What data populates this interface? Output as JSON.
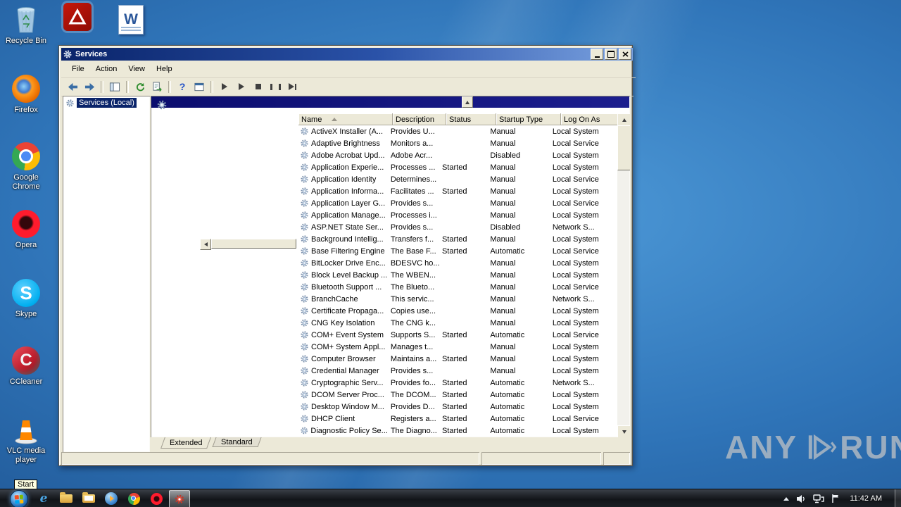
{
  "colors": {
    "selection_navy": "#0a246a",
    "titlebar_gradient": [
      "#0a246a",
      "#7aa2e0"
    ],
    "extended_header_navy": "#0d0f72",
    "desktop_blue": "#2f74b8",
    "taskbar_dark": "#121519"
  },
  "desktop": {
    "icons": [
      {
        "label": "Recycle Bin"
      },
      {
        "label": "Firefox"
      },
      {
        "label": "Google Chrome"
      },
      {
        "label": "Opera"
      },
      {
        "label": "Skype"
      },
      {
        "label": "CCleaner"
      },
      {
        "label": "VLC media player"
      }
    ],
    "top_shortcuts": [
      "adobe-reader",
      "word-document"
    ]
  },
  "watermark": {
    "left": "ANY",
    "right": "RUN"
  },
  "window": {
    "title": "Services",
    "menu_items": [
      "File",
      "Action",
      "View",
      "Help"
    ],
    "toolbar_buttons": [
      "back",
      "forward",
      "show-console-tree",
      "refresh",
      "export-list",
      "help",
      "properties",
      "start-service",
      "resume-service",
      "stop-service",
      "pause-service",
      "restart-service"
    ],
    "tree_root": "Services (Local)",
    "columns": [
      "Name",
      "Description",
      "Status",
      "Startup Type",
      "Log On As"
    ],
    "tabs": [
      "Extended",
      "Standard"
    ],
    "rows": [
      {
        "name": "ActiveX Installer (A...",
        "description": "Provides U...",
        "status": "",
        "startup_type": "Manual",
        "log_on_as": "Local System"
      },
      {
        "name": "Adaptive Brightness",
        "description": "Monitors a...",
        "status": "",
        "startup_type": "Manual",
        "log_on_as": "Local Service"
      },
      {
        "name": "Adobe Acrobat Upd...",
        "description": "Adobe Acr...",
        "status": "",
        "startup_type": "Disabled",
        "log_on_as": "Local System"
      },
      {
        "name": "Application Experie...",
        "description": "Processes ...",
        "status": "Started",
        "startup_type": "Manual",
        "log_on_as": "Local System"
      },
      {
        "name": "Application Identity",
        "description": "Determines...",
        "status": "",
        "startup_type": "Manual",
        "log_on_as": "Local Service"
      },
      {
        "name": "Application Informa...",
        "description": "Facilitates ...",
        "status": "Started",
        "startup_type": "Manual",
        "log_on_as": "Local System"
      },
      {
        "name": "Application Layer G...",
        "description": "Provides s...",
        "status": "",
        "startup_type": "Manual",
        "log_on_as": "Local Service"
      },
      {
        "name": "Application Manage...",
        "description": "Processes i...",
        "status": "",
        "startup_type": "Manual",
        "log_on_as": "Local System"
      },
      {
        "name": "ASP.NET State Ser...",
        "description": "Provides s...",
        "status": "",
        "startup_type": "Disabled",
        "log_on_as": "Network S..."
      },
      {
        "name": "Background Intellig...",
        "description": "Transfers f...",
        "status": "Started",
        "startup_type": "Manual",
        "log_on_as": "Local System"
      },
      {
        "name": "Base Filtering Engine",
        "description": "The Base F...",
        "status": "Started",
        "startup_type": "Automatic",
        "log_on_as": "Local Service"
      },
      {
        "name": "BitLocker Drive Enc...",
        "description": "BDESVC ho...",
        "status": "",
        "startup_type": "Manual",
        "log_on_as": "Local System"
      },
      {
        "name": "Block Level Backup ...",
        "description": "The WBEN...",
        "status": "",
        "startup_type": "Manual",
        "log_on_as": "Local System"
      },
      {
        "name": "Bluetooth Support ...",
        "description": "The Blueto...",
        "status": "",
        "startup_type": "Manual",
        "log_on_as": "Local Service"
      },
      {
        "name": "BranchCache",
        "description": "This servic...",
        "status": "",
        "startup_type": "Manual",
        "log_on_as": "Network S..."
      },
      {
        "name": "Certificate Propaga...",
        "description": "Copies use...",
        "status": "",
        "startup_type": "Manual",
        "log_on_as": "Local System"
      },
      {
        "name": "CNG Key Isolation",
        "description": "The CNG k...",
        "status": "",
        "startup_type": "Manual",
        "log_on_as": "Local System"
      },
      {
        "name": "COM+ Event System",
        "description": "Supports S...",
        "status": "Started",
        "startup_type": "Automatic",
        "log_on_as": "Local Service"
      },
      {
        "name": "COM+ System Appl...",
        "description": "Manages t...",
        "status": "",
        "startup_type": "Manual",
        "log_on_as": "Local System"
      },
      {
        "name": "Computer Browser",
        "description": "Maintains a...",
        "status": "Started",
        "startup_type": "Manual",
        "log_on_as": "Local System"
      },
      {
        "name": "Credential Manager",
        "description": "Provides s...",
        "status": "",
        "startup_type": "Manual",
        "log_on_as": "Local System"
      },
      {
        "name": "Cryptographic Serv...",
        "description": "Provides fo...",
        "status": "Started",
        "startup_type": "Automatic",
        "log_on_as": "Network S..."
      },
      {
        "name": "DCOM Server Proc...",
        "description": "The DCOM...",
        "status": "Started",
        "startup_type": "Automatic",
        "log_on_as": "Local System"
      },
      {
        "name": "Desktop Window M...",
        "description": "Provides D...",
        "status": "Started",
        "startup_type": "Automatic",
        "log_on_as": "Local System"
      },
      {
        "name": "DHCP Client",
        "description": "Registers a...",
        "status": "Started",
        "startup_type": "Automatic",
        "log_on_as": "Local Service"
      },
      {
        "name": "Diagnostic Policy Se...",
        "description": "The Diagno...",
        "status": "Started",
        "startup_type": "Automatic",
        "log_on_as": "Local System"
      }
    ]
  },
  "taskbar": {
    "start_tooltip": "Start",
    "clock": "11:42 AM",
    "buttons": [
      "internet-explorer",
      "windows-explorer",
      "documents-folder",
      "media-player",
      "google-chrome",
      "opera",
      "services-active"
    ],
    "tray_icons": [
      "hidden-icons-chevron",
      "volume",
      "network",
      "action-center-flag"
    ]
  }
}
